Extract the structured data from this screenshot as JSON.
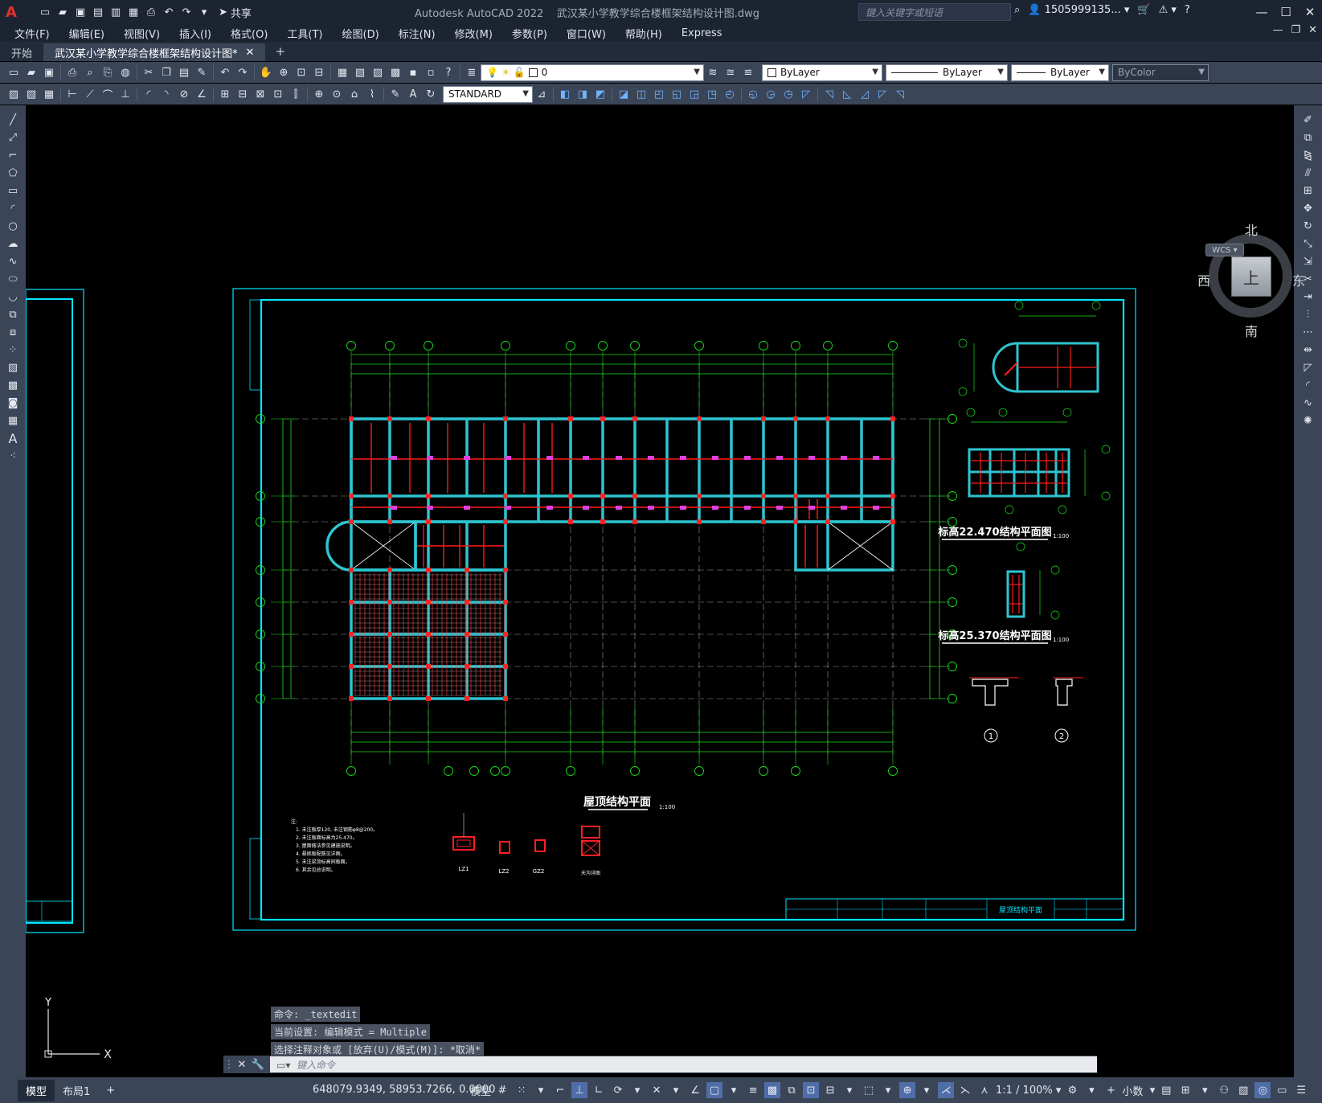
{
  "app": {
    "title_app": "Autodesk AutoCAD 2022",
    "title_file": "武汉某小学教学综合楼框架结构设计图.dwg",
    "share_label": "共享",
    "search_placeholder": "键入关键字或短语",
    "user": "1505999135...",
    "help": "?"
  },
  "menu": {
    "items": [
      "文件(F)",
      "编辑(E)",
      "视图(V)",
      "插入(I)",
      "格式(O)",
      "工具(T)",
      "绘图(D)",
      "标注(N)",
      "修改(M)",
      "参数(P)",
      "窗口(W)",
      "帮助(H)",
      "Express"
    ]
  },
  "tabs": {
    "items": [
      {
        "label": "开始"
      },
      {
        "label": "武汉某小学教学综合楼框架结构设计图*"
      }
    ]
  },
  "toolbar": {
    "layer_value": "0",
    "color_value": "ByLayer",
    "linetype_value": "ByLayer",
    "lineweight_value": "ByLayer",
    "plotstyle_value": "ByColor",
    "textstyle_value": "STANDARD"
  },
  "viewcube": {
    "north": "北",
    "south": "南",
    "east": "东",
    "west": "西",
    "face": "上",
    "wcs": "WCS"
  },
  "drawing": {
    "main_title": "屋顶结构平面",
    "main_scale": "1:100",
    "plan1_title": "标高22.470结构平面图",
    "plan1_scale": "1:100",
    "plan2_title": "标高25.370结构平面图",
    "plan2_scale": "1:100",
    "sheet_name": "屋顶结构平面",
    "detail_labels": [
      "LZ1",
      "LZ2",
      "GZ2",
      "天沟详图"
    ],
    "section_marks": [
      "1",
      "2"
    ],
    "top_axes": [
      "1",
      "2",
      "3",
      "5",
      "6",
      "7",
      "8",
      "9",
      "10",
      "11",
      "12"
    ],
    "bottom_axes": [
      "1",
      "3",
      "4",
      "5",
      "6",
      "7",
      "8",
      "9",
      "10",
      "12"
    ],
    "row_axes": [
      "J",
      "H",
      "G",
      "E",
      "D",
      "C",
      "B",
      "A"
    ],
    "right_row_axes": [
      "J",
      "H",
      "G",
      "F",
      "D",
      "C",
      "B",
      "A"
    ],
    "notes": [
      "注:",
      "1. 未注板厚120, 未注钢筋φ8@200。",
      "2. 未注板面标高为25.470。",
      "3. 屋面做法参见建施说明。",
      "4. 悬挑板配筋见详图。",
      "5. 未注梁顶标高同板面。",
      "6. 其余见总说明。"
    ]
  },
  "command": {
    "history": [
      "命令: _textedit",
      "当前设置: 编辑模式 = Multiple",
      "选择注释对象或 [放弃(U)/模式(M)]: *取消*"
    ],
    "placeholder": "键入命令"
  },
  "statusbar": {
    "tab_model": "模型",
    "tab_layout1": "布局1",
    "coords": "648079.9349, 58953.7266, 0.0000",
    "mode_model": "模型",
    "scale": "1:1 / 100%",
    "units": "小数"
  }
}
